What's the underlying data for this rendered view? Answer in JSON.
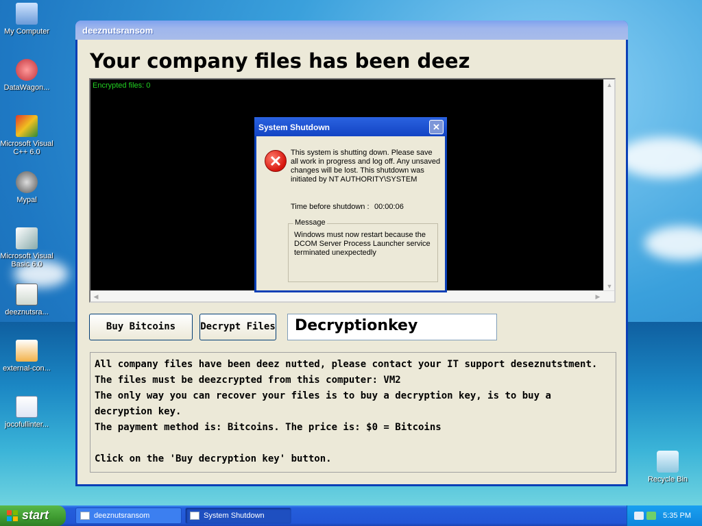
{
  "desktop": {
    "icons": [
      {
        "label": "My Computer"
      },
      {
        "label": "DataWagon..."
      },
      {
        "label": "Microsoft Visual C++ 6.0"
      },
      {
        "label": "Mypal"
      },
      {
        "label": "Microsoft Visual Basic 6.0"
      },
      {
        "label": "deeznutsra..."
      },
      {
        "label": "external-con..."
      },
      {
        "label": "jocofullinter..."
      },
      {
        "label": "Recycle Bin"
      }
    ]
  },
  "window": {
    "title": "deeznutsransom",
    "heading": "Your company files has been deez",
    "console_text": "Encrypted files: 0",
    "buy_button": "Buy Bitcoins",
    "decrypt_button": "Decrypt Files",
    "key_value": "Decryptionkey",
    "notice_lines": [
      "All company files have been deez nutted, please contact your IT support deseznutstment.",
      "The files must be deezcrypted from this computer: VM2",
      "The only way you can recover your files is to buy a decryption key, is to buy a decryption key.",
      "The payment method is: Bitcoins.  The price is: $0 =  Bitcoins",
      "",
      "Click on the 'Buy decryption key' button."
    ]
  },
  "dialog": {
    "title": "System Shutdown",
    "close": "✕",
    "message": "This system is shutting down. Please save all work in progress and log off. Any unsaved changes will be lost. This shutdown was initiated by NT AUTHORITY\\SYSTEM",
    "time_label": "Time before shutdown :",
    "time_value": "00:00:06",
    "group_label": "Message",
    "group_text": "Windows must now restart because the DCOM Server Process Launcher service terminated unexpectedly"
  },
  "taskbar": {
    "start": "start",
    "tasks": [
      {
        "label": "deeznutsransom"
      },
      {
        "label": "System Shutdown"
      }
    ],
    "clock": "5:35 PM"
  },
  "colors": {
    "console_text": "#22d322",
    "title_active": "#1344c4",
    "error_red": "#d6150c"
  }
}
